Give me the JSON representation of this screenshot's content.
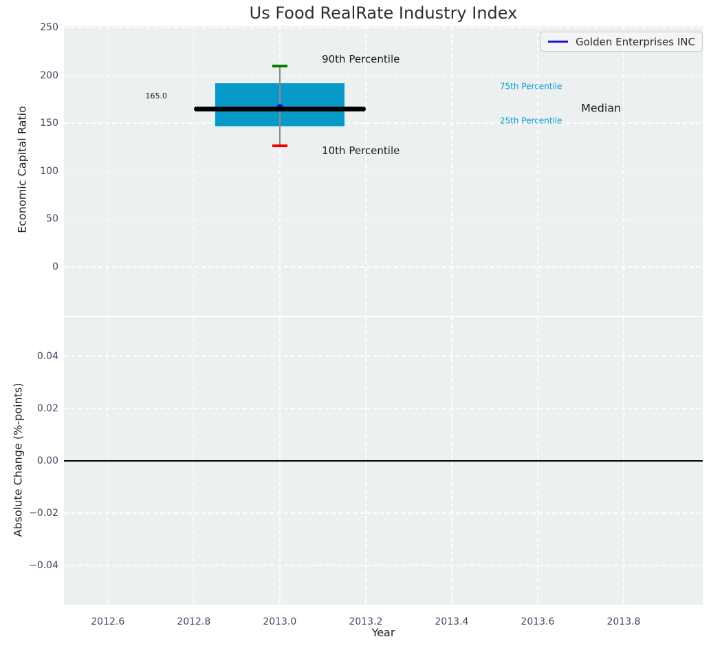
{
  "title": "Us Food RealRate Industry Index",
  "legend": {
    "label": "Golden Enterprises INC"
  },
  "colors": {
    "plot_bg": "#ecf0f1",
    "grid": "#ffffff",
    "box_fill": "#079ac9",
    "box_bottom_edge": "#aadcee",
    "median_line": "#000000",
    "whisker": "#8a8a8a",
    "cap_90": "#008000",
    "cap_10": "#ee0000",
    "series_blue": "#1414d2",
    "tick_label": "#3b4a61",
    "text_dark": "#1a1a1a",
    "percentile_text": "#089bca",
    "zero_line": "#000000",
    "legend_bg": "#f5f5f7",
    "legend_border": "#c9c9cf"
  },
  "chart_data": [
    {
      "type": "boxplot",
      "subplot": "top",
      "title": "Us Food RealRate Industry Index",
      "ylabel": "Economic Capital Ratio",
      "xlabel": "",
      "xlim": [
        2012.498,
        2013.984
      ],
      "ylim": [
        -51,
        251.4
      ],
      "grid": true,
      "legend_position": "upper right",
      "xticks": [
        {
          "v": 2012.6,
          "label": "2012.6"
        },
        {
          "v": 2012.8,
          "label": "2012.8"
        },
        {
          "v": 2013.0,
          "label": "2013.0"
        },
        {
          "v": 2013.2,
          "label": "2013.2"
        },
        {
          "v": 2013.4,
          "label": "2013.4"
        },
        {
          "v": 2013.6,
          "label": "2013.6"
        },
        {
          "v": 2013.8,
          "label": "2013.8"
        }
      ],
      "yticks": [
        {
          "v": 0,
          "label": "0"
        },
        {
          "v": 50,
          "label": "50"
        },
        {
          "v": 100,
          "label": "100"
        },
        {
          "v": 150,
          "label": "150"
        },
        {
          "v": 200,
          "label": "200"
        },
        {
          "v": 250,
          "label": "250"
        }
      ],
      "box": {
        "x_center": 2013.0,
        "p10": 126.5,
        "p25": 147.0,
        "median": 165.0,
        "p75": 192.0,
        "p90": 210.0,
        "box_x": [
          2012.85,
          2013.15
        ],
        "median_x": [
          2012.8,
          2013.2
        ],
        "cap_half_width": 0.018
      },
      "series": [
        {
          "name": "Golden Enterprises INC",
          "x": [
            2013.0
          ],
          "y": [
            166.5
          ],
          "marker": "dot"
        }
      ],
      "annotations": [
        {
          "text": "165.0",
          "x": 2012.738,
          "y": 178.0,
          "size": 11,
          "color": "#1a1a1a",
          "anchor": "end"
        },
        {
          "text": "90th Percentile",
          "x": 2013.098,
          "y": 216.0,
          "size": 15,
          "color": "#1a1a1a",
          "anchor": "start"
        },
        {
          "text": "10th Percentile",
          "x": 2013.098,
          "y": 120.5,
          "size": 15,
          "color": "#1a1a1a",
          "anchor": "start"
        },
        {
          "text": "75th Percentile",
          "x": 2013.512,
          "y": 188.0,
          "size": 12,
          "color": "#089bca",
          "anchor": "start"
        },
        {
          "text": "25th Percentile",
          "x": 2013.512,
          "y": 152.0,
          "size": 12,
          "color": "#089bca",
          "anchor": "start"
        },
        {
          "text": "Median",
          "x": 2013.701,
          "y": 165.0,
          "size": 16,
          "color": "#1a1a1a",
          "anchor": "start"
        }
      ]
    },
    {
      "type": "line",
      "subplot": "bottom",
      "ylabel": "Absolute Change (%-points)",
      "xlabel": "Year",
      "xlim": [
        2012.498,
        2013.984
      ],
      "ylim": [
        -0.055,
        0.055
      ],
      "grid": true,
      "zero_line": 0.0,
      "xticks": [
        {
          "v": 2012.6,
          "label": "2012.6"
        },
        {
          "v": 2012.8,
          "label": "2012.8"
        },
        {
          "v": 2013.0,
          "label": "2013.0"
        },
        {
          "v": 2013.2,
          "label": "2013.2"
        },
        {
          "v": 2013.4,
          "label": "2013.4"
        },
        {
          "v": 2013.6,
          "label": "2013.6"
        },
        {
          "v": 2013.8,
          "label": "2013.8"
        }
      ],
      "yticks": [
        {
          "v": 0.04,
          "label": "0.04"
        },
        {
          "v": 0.02,
          "label": "0.02"
        },
        {
          "v": 0.0,
          "label": "0.00"
        },
        {
          "v": -0.02,
          "label": "−0.02"
        },
        {
          "v": -0.04,
          "label": "−0.04"
        }
      ],
      "series": []
    }
  ]
}
